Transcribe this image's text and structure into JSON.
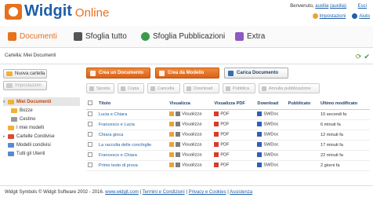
{
  "app": {
    "brand": "Widgit",
    "sub": "Online"
  },
  "header": {
    "welcome_prefix": "Benvenuto,",
    "user": "auxilia",
    "second_user": "(auxilia)",
    "exit": "Esci",
    "settings": "Impostazioni",
    "help": "Aiuto"
  },
  "nav": {
    "items": [
      {
        "label": "Documenti",
        "icon": "documents-icon"
      },
      {
        "label": "Sfoglia tutto",
        "icon": "browse-icon"
      },
      {
        "label": "Sfoglia Pubblicazioni",
        "icon": "globe-icon"
      },
      {
        "label": "Extra",
        "icon": "extras-icon"
      }
    ]
  },
  "breadcrumb": "Cartella: Miei Documenti",
  "sidebar": {
    "new_folder": "Nuova cartella",
    "settings": "Impostazioni",
    "tree": [
      {
        "label": "Miei Documenti"
      },
      {
        "label": "Bozze"
      },
      {
        "label": "Cestino"
      },
      {
        "label": "I miei modelli"
      },
      {
        "label": "Cartelle Condivise"
      },
      {
        "label": "Modelli condivisi"
      },
      {
        "label": "Tutti gli Utenti"
      }
    ]
  },
  "actions": {
    "new_document": "Crea un Documento",
    "from_template": "Crea da Modello",
    "upload": "Carica Documento"
  },
  "toolbar": {
    "move": "Sposta",
    "copy": "Copia",
    "delete": "Cancella",
    "download": "Download",
    "publish": "Pubblica",
    "unpublish": "Annulla pubblicazione"
  },
  "table": {
    "headers": [
      "Titolo",
      "Visualizza",
      "Visualizza PDF",
      "Download",
      "Pubblicato",
      "Ultimo modificato"
    ],
    "view_label": "Visualizza",
    "pdf_label": "PDF",
    "download_label": "SWDoc",
    "rows": [
      {
        "title": "Lucia e Chiara",
        "modified": "10 secondi fa"
      },
      {
        "title": "Francesco e Lucia",
        "modified": "6 minuti fa"
      },
      {
        "title": "Chiara gioca",
        "modified": "12 minuti fa"
      },
      {
        "title": "La raccolta delle conchiglie",
        "modified": "17 minuti fa"
      },
      {
        "title": "Francesco e Chiara",
        "modified": "22 minuti fa"
      },
      {
        "title": "Primo testo di prova",
        "modified": "2 giorni fa"
      }
    ]
  },
  "footer": {
    "copyright": "Widgit Symbols © Widgit Software 2002 - 2016.",
    "site": "www.widgit.com",
    "terms": "Termini e Condizioni",
    "privacy": "Privacy e Cookies",
    "support": "Assistenza"
  },
  "colors": {
    "accent": "#e8711c",
    "brand": "#1f5fa6"
  }
}
